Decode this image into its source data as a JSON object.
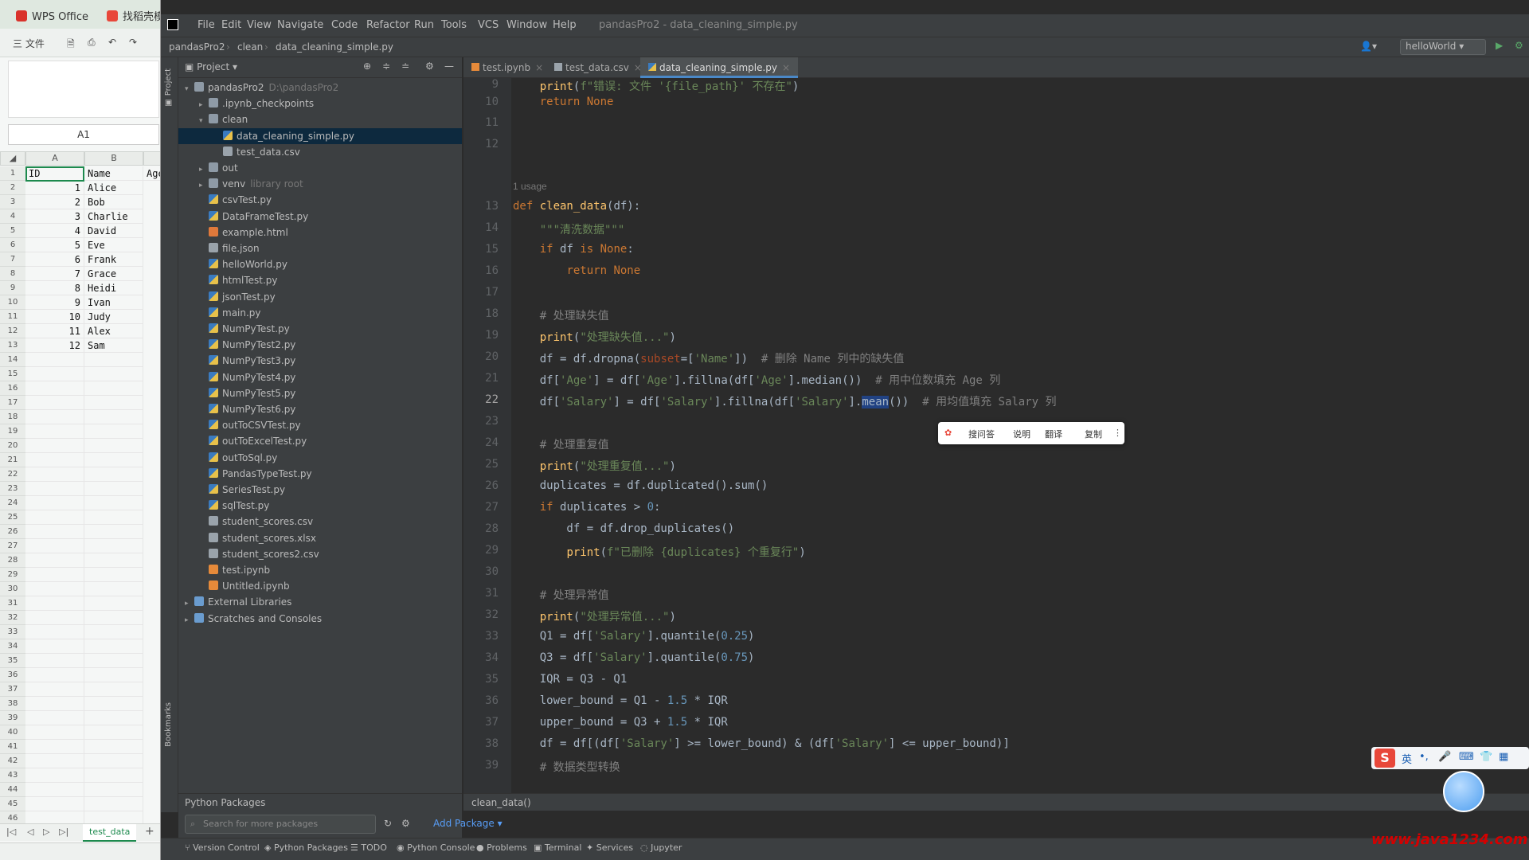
{
  "wps": {
    "tabs": [
      "WPS Office",
      "找稻壳模板"
    ],
    "toolbar_menu": "三 文件",
    "namebox": "A1",
    "columns": [
      "A",
      "B"
    ],
    "header_row": [
      "ID",
      "Name",
      "Age"
    ],
    "ids": [
      "1",
      "2",
      "3",
      "4",
      "5",
      "6",
      "7",
      "8",
      "9",
      "10",
      "11",
      "12"
    ],
    "names": [
      "Alice",
      "Bob",
      "Charlie",
      "David",
      "Eve",
      "Frank",
      "Grace",
      "Heidi",
      "Ivan",
      "Judy",
      "Alex",
      "Sam"
    ],
    "row_numbers": [
      "1",
      "2",
      "3",
      "4",
      "5",
      "6",
      "7",
      "8",
      "9",
      "10",
      "11",
      "12",
      "13",
      "14",
      "15",
      "16",
      "17",
      "18",
      "19",
      "20",
      "21",
      "22",
      "23",
      "24",
      "25",
      "26",
      "27",
      "28",
      "29",
      "30",
      "31",
      "32",
      "33",
      "34",
      "35",
      "36",
      "37",
      "38",
      "39",
      "40",
      "41",
      "42",
      "43",
      "44",
      "45",
      "46"
    ],
    "sheet_tab": "test_data"
  },
  "ide": {
    "menu": [
      "File",
      "Edit",
      "View",
      "Navigate",
      "Code",
      "Refactor",
      "Run",
      "Tools",
      "VCS",
      "Window",
      "Help"
    ],
    "title": "pandasPro2 - data_cleaning_simple.py",
    "breadcrumb": [
      "pandasPro2",
      "clean",
      "data_cleaning_simple.py"
    ],
    "run_config": "helloWorld",
    "project_label": "Project",
    "tree": [
      {
        "label": "pandasPro2",
        "hint": "D:\\pandasPro2",
        "indent": 0,
        "arrow": "▾",
        "icon": "folder"
      },
      {
        "label": ".ipynb_checkpoints",
        "hint": "",
        "indent": 1,
        "arrow": "▸",
        "icon": "folder"
      },
      {
        "label": "clean",
        "hint": "",
        "indent": 1,
        "arrow": "▾",
        "icon": "folder"
      },
      {
        "label": "data_cleaning_simple.py",
        "hint": "",
        "indent": 2,
        "arrow": "",
        "icon": "py",
        "selected": true
      },
      {
        "label": "test_data.csv",
        "hint": "",
        "indent": 2,
        "arrow": "",
        "icon": "file"
      },
      {
        "label": "out",
        "hint": "",
        "indent": 1,
        "arrow": "▸",
        "icon": "folder"
      },
      {
        "label": "venv",
        "hint": "library root",
        "indent": 1,
        "arrow": "▸",
        "icon": "folder"
      },
      {
        "label": "csvTest.py",
        "hint": "",
        "indent": 1,
        "arrow": "",
        "icon": "py"
      },
      {
        "label": "DataFrameTest.py",
        "hint": "",
        "indent": 1,
        "arrow": "",
        "icon": "py"
      },
      {
        "label": "example.html",
        "hint": "",
        "indent": 1,
        "arrow": "",
        "icon": "html"
      },
      {
        "label": "file.json",
        "hint": "",
        "indent": 1,
        "arrow": "",
        "icon": "file"
      },
      {
        "label": "helloWorld.py",
        "hint": "",
        "indent": 1,
        "arrow": "",
        "icon": "py"
      },
      {
        "label": "htmlTest.py",
        "hint": "",
        "indent": 1,
        "arrow": "",
        "icon": "py"
      },
      {
        "label": "jsonTest.py",
        "hint": "",
        "indent": 1,
        "arrow": "",
        "icon": "py"
      },
      {
        "label": "main.py",
        "hint": "",
        "indent": 1,
        "arrow": "",
        "icon": "py"
      },
      {
        "label": "NumPyTest.py",
        "hint": "",
        "indent": 1,
        "arrow": "",
        "icon": "py"
      },
      {
        "label": "NumPyTest2.py",
        "hint": "",
        "indent": 1,
        "arrow": "",
        "icon": "py"
      },
      {
        "label": "NumPyTest3.py",
        "hint": "",
        "indent": 1,
        "arrow": "",
        "icon": "py"
      },
      {
        "label": "NumPyTest4.py",
        "hint": "",
        "indent": 1,
        "arrow": "",
        "icon": "py"
      },
      {
        "label": "NumPyTest5.py",
        "hint": "",
        "indent": 1,
        "arrow": "",
        "icon": "py"
      },
      {
        "label": "NumPyTest6.py",
        "hint": "",
        "indent": 1,
        "arrow": "",
        "icon": "py"
      },
      {
        "label": "outToCSVTest.py",
        "hint": "",
        "indent": 1,
        "arrow": "",
        "icon": "py"
      },
      {
        "label": "outToExcelTest.py",
        "hint": "",
        "indent": 1,
        "arrow": "",
        "icon": "py"
      },
      {
        "label": "outToSql.py",
        "hint": "",
        "indent": 1,
        "arrow": "",
        "icon": "py"
      },
      {
        "label": "PandasTypeTest.py",
        "hint": "",
        "indent": 1,
        "arrow": "",
        "icon": "py"
      },
      {
        "label": "SeriesTest.py",
        "hint": "",
        "indent": 1,
        "arrow": "",
        "icon": "py"
      },
      {
        "label": "sqlTest.py",
        "hint": "",
        "indent": 1,
        "arrow": "",
        "icon": "py"
      },
      {
        "label": "student_scores.csv",
        "hint": "",
        "indent": 1,
        "arrow": "",
        "icon": "file"
      },
      {
        "label": "student_scores.xlsx",
        "hint": "",
        "indent": 1,
        "arrow": "",
        "icon": "file"
      },
      {
        "label": "student_scores2.csv",
        "hint": "",
        "indent": 1,
        "arrow": "",
        "icon": "file"
      },
      {
        "label": "test.ipynb",
        "hint": "",
        "indent": 1,
        "arrow": "",
        "icon": "nb"
      },
      {
        "label": "Untitled.ipynb",
        "hint": "",
        "indent": 1,
        "arrow": "",
        "icon": "nb"
      },
      {
        "label": "External Libraries",
        "hint": "",
        "indent": 0,
        "arrow": "▸",
        "icon": "lib"
      },
      {
        "label": "Scratches and Consoles",
        "hint": "",
        "indent": 0,
        "arrow": "▸",
        "icon": "lib"
      }
    ],
    "editor_tabs": [
      "test.ipynb",
      "test_data.csv",
      "data_cleaning_simple.py"
    ],
    "usage_hint": "1 usage",
    "popup": [
      "搜问答",
      "说明",
      "翻译",
      "复制"
    ],
    "code_breadcrumb": "clean_data()",
    "python_packages_title": "Python Packages",
    "search_packages_placeholder": "Search for more packages",
    "add_package": "Add Package",
    "bottom_tools": [
      "Version Control",
      "Python Packages",
      "TODO",
      "Python Console",
      "Problems",
      "Terminal",
      "Services",
      "Jupyter"
    ]
  },
  "overlay": {
    "ime_logo": "S",
    "ime_lang": "英",
    "watermark": "www.java1234.com"
  }
}
